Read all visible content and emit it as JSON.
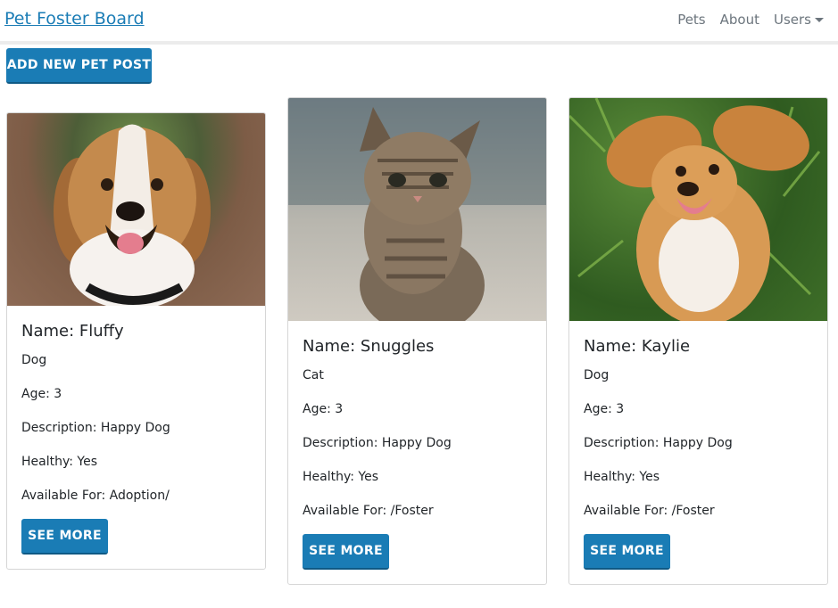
{
  "navbar": {
    "brand": "Pet Foster Board",
    "links": [
      "Pets",
      "About",
      "Users"
    ]
  },
  "actions": {
    "add_label": "ADD NEW PET POST"
  },
  "pets": [
    {
      "name": "Name: Fluffy",
      "species": "Dog",
      "age": "Age: 3",
      "description": "Description: Happy Dog",
      "healthy": "Healthy: Yes",
      "available": "Available For: Adoption/",
      "button": "SEE MORE",
      "image": "beagle-photo"
    },
    {
      "name": "Name: Snuggles",
      "species": "Cat",
      "age": "Age: 3",
      "description": "Description: Happy Dog",
      "healthy": "Healthy: Yes",
      "available": "Available For: /Foster",
      "button": "SEE MORE",
      "image": "tabby-kitten-photo"
    },
    {
      "name": "Name: Kaylie",
      "species": "Dog",
      "age": "Age: 3",
      "description": "Description: Happy Dog",
      "healthy": "Healthy: Yes",
      "available": "Available For: /Foster",
      "button": "SEE MORE",
      "image": "spaniel-puppy-photo"
    }
  ],
  "colors": {
    "primary": "#1a7cb5",
    "text": "#212529",
    "nav_text": "#6c757d",
    "card_border": "#d6d6d6"
  }
}
